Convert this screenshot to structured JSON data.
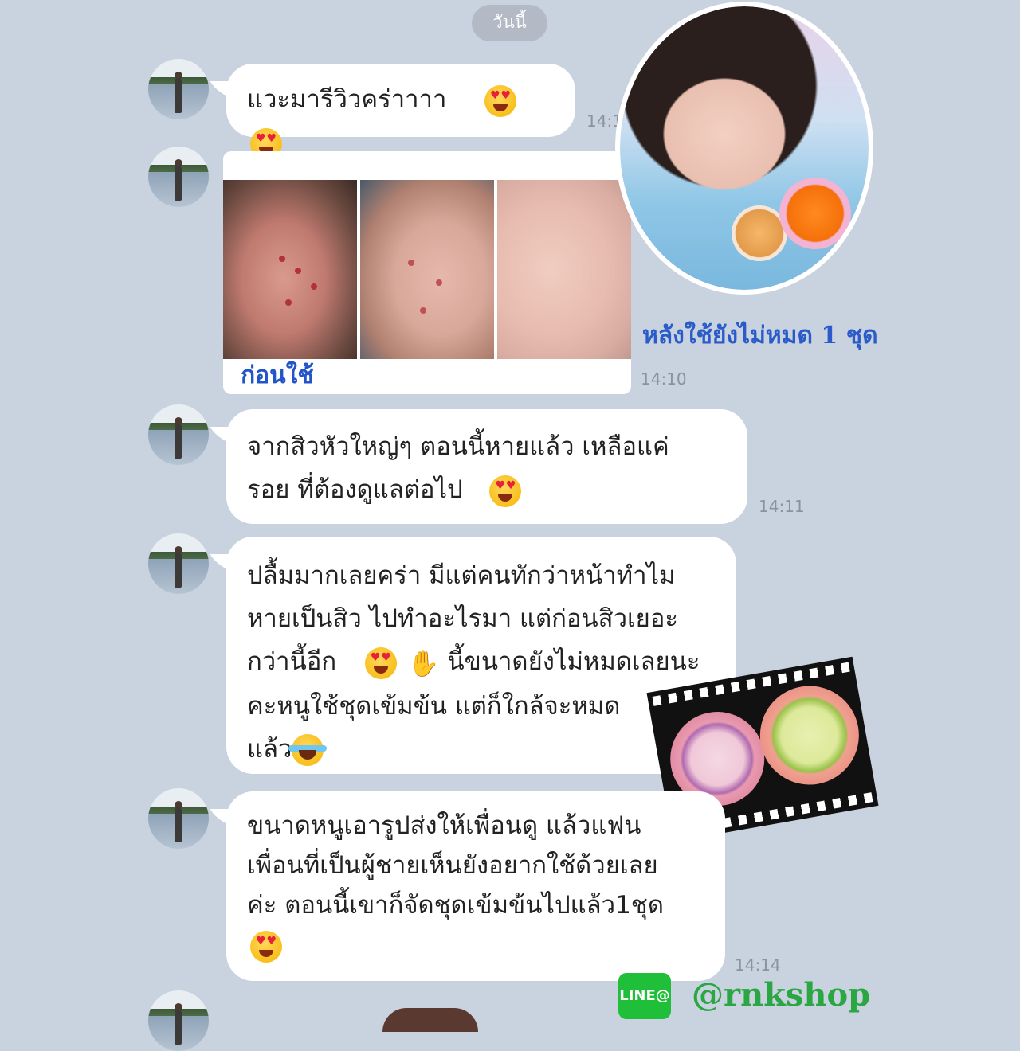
{
  "chat": {
    "date_label": "วันนี้",
    "messages": [
      {
        "text": "แวะมารีวิวคร่าาาา",
        "time": "14:1"
      },
      {
        "caption": "ก่อนใช้",
        "time": "14:10"
      },
      {
        "line1": "จากสิวหัวใหญ่ๆ  ตอนนี้หายแล้ว  เหลือแค่",
        "line2": "รอย ที่ต้องดูแลต่อไป",
        "time": "14:11"
      },
      {
        "line1": "ปลื้มมากเลยคร่า  มีแต่คนทักว่าหน้าทำไม",
        "line2": "หายเป็นสิว ไปทำอะไรมา แต่ก่อนสิวเยอะ",
        "line3": "กว่านี้อีก",
        "line3b": "นี้ขนาดยังไม่หมดเลยนะ",
        "line4": "คะหนูใช้ชุดเข้มข้น แต่ก็ใกล้จะหมด",
        "line5": "แล้ว"
      },
      {
        "line1": "ขนาดหนูเอารูปส่งให้เพื่อนดู แล้วแฟน",
        "line2": "เพื่อนที่เป็นผู้ชายเห็นยังอยากใช้ด้วยเลย",
        "line3": "ค่ะ  ตอนนี้เขาก็จัดชุดเข้มข้นไปแล้ว1ชุด",
        "time": "14:14"
      }
    ]
  },
  "overlay": {
    "after_caption": "หลังใช้ยังไม่หมด 1 ชุด",
    "line_logo": "LINE@",
    "shop_handle": "@rnkshop"
  },
  "icons": [
    "heart-eyes-emoji",
    "pray-emoji",
    "tears-of-joy-emoji"
  ]
}
